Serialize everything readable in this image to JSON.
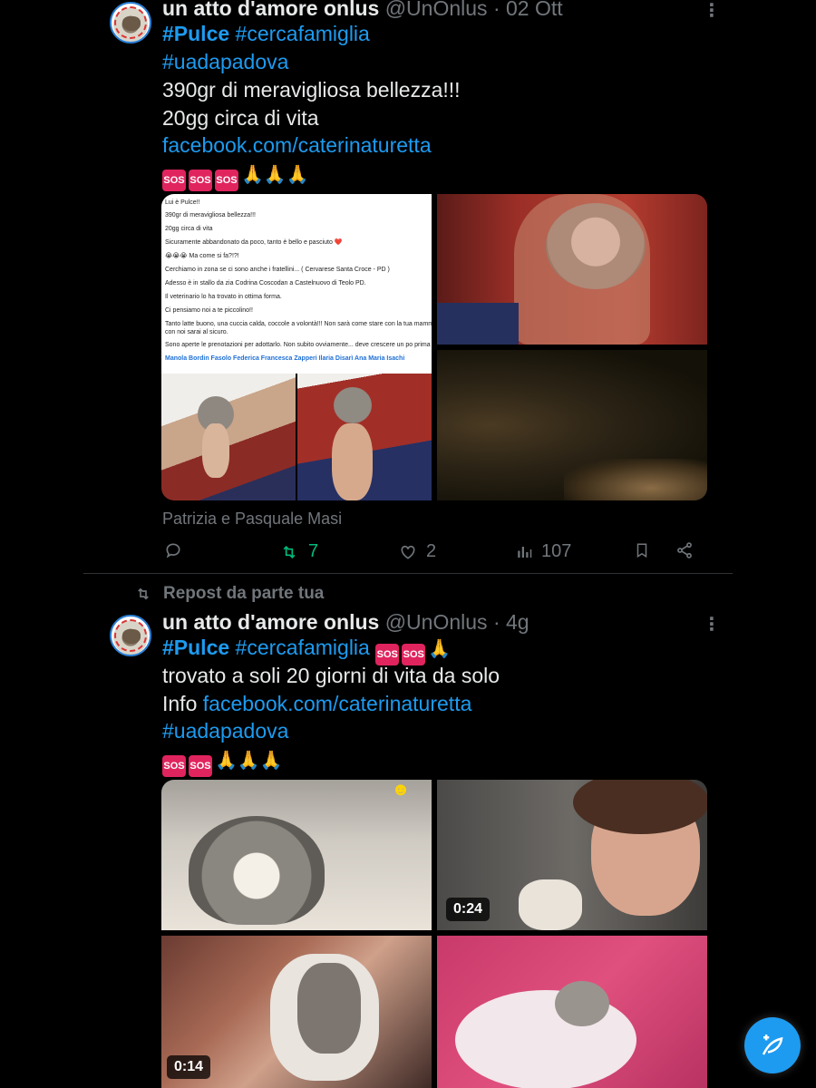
{
  "tweets": [
    {
      "name": "un atto d'amore onlus",
      "handle": "@UnOnlus",
      "time": "· 02 Ott",
      "lines": {
        "l1_tag1": "#Pulce",
        "l1_tag2": "#cercafamiglia",
        "l2_tag": "#uadapadova",
        "l3": "390gr di meravigliosa bellezza!!!",
        "l4": "20gg circa di vita",
        "l5_link": "facebook.com/caterinaturetta"
      },
      "sos_label": "SOS",
      "post_screenshot": {
        "lines": [
          "Lui è Pulce!!",
          "390gr di meravigliosa bellezza!!!",
          "20gg circa di vita",
          "Sicuramente abbandonato da poco, tanto è bello e pasciuto ❤️",
          "😭😭😭 Ma come si fa?!?!",
          "Cerchiamo in zona se ci sono anche i fratellini... ( Cervarese Santa Croce - PD )",
          "Adesso è in stallo da zia Codrina Coscodan a Castelnuovo di Teolo PD.",
          "Il veterinario lo ha trovato in ottima forma.",
          "Ci pensiamo noi a te piccolino!!",
          "Tanto latte buono, una cuccia calda, coccole a volontà!!! Non sarà come stare con la tua mamma, ma",
          "con noi sarai al sicuro.",
          "Sono aperte le prenotazioni per adottarlo. Non subito ovviamente... deve crescere un po prima",
          "Manola Bordin Fasolo Federica Francesca Zapperi Ilaria Disarì Ana Maria Isachi"
        ]
      },
      "caption": "Patrizia e Pasquale Masi",
      "stats": {
        "reposts": "7",
        "likes": "2",
        "views": "107"
      }
    },
    {
      "repost_label": "Repost da parte tua",
      "name": "un atto d'amore onlus",
      "handle": "@UnOnlus",
      "time": "· 4g",
      "lines": {
        "l1_tag1": "#Pulce",
        "l1_tag2": "#cercafamiglia",
        "l2": "trovato a soli 20 giorni di vita da solo",
        "l3_prefix": "Info",
        "l3_link": "facebook.com/caterinaturetta",
        "l4_tag": "#uadapadova"
      },
      "durations": {
        "video1": "0:24",
        "video2": "0:14"
      }
    }
  ],
  "icons": {
    "more": "more-vertical-icon",
    "reply": "reply-icon",
    "repost": "repost-icon",
    "like": "heart-icon",
    "views": "views-icon",
    "bookmark": "bookmark-icon",
    "share": "share-icon",
    "compose": "compose-icon"
  },
  "colors": {
    "accent": "#1d9bf0",
    "repost_green": "#00ba7c",
    "muted": "#71767b",
    "sos": "#e0245e"
  }
}
